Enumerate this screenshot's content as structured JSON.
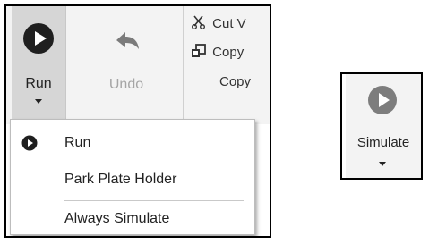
{
  "ribbon": {
    "run_label": "Run",
    "undo_label": "Undo",
    "clipboard": {
      "cut_label": "Cut V",
      "copy_label": "Copy",
      "copy2_label": "Copy"
    }
  },
  "run_menu": {
    "items": [
      {
        "label": "Run",
        "icon": "play-circle-icon"
      },
      {
        "label": "Park Plate Holder"
      },
      {
        "label": "Always Simulate"
      }
    ]
  },
  "simulate": {
    "label": "Simulate"
  },
  "colors": {
    "run_icon": "#1f1f1f",
    "undo_icon": "#7b7b7b",
    "simulate_icon": "#7d7d7d",
    "ribbon_bg": "#f3f3f3",
    "run_button_bg": "#d6d6d6"
  }
}
